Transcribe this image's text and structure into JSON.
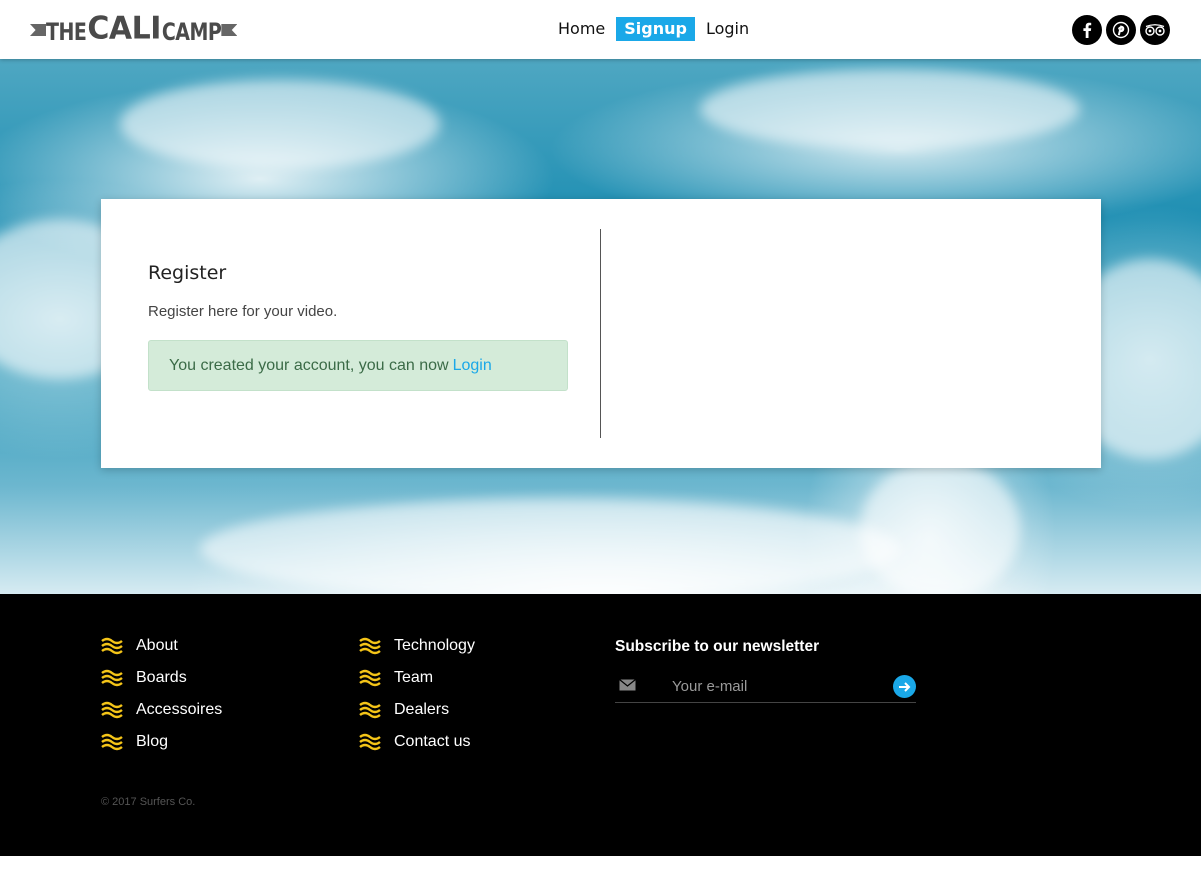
{
  "header": {
    "logo_text": {
      "the": "THE",
      "cali": "CALI",
      "camp": "CAMP"
    },
    "nav": [
      {
        "label": "Home",
        "active": false
      },
      {
        "label": "Signup",
        "active": true
      },
      {
        "label": "Login",
        "active": false
      }
    ],
    "social_icons": [
      "facebook-icon",
      "pinterest-icon",
      "tripadvisor-icon"
    ]
  },
  "card": {
    "title": "Register",
    "subtitle": "Register here for your video.",
    "alert_text": "You created your account, you can now",
    "alert_link": "Login"
  },
  "footer": {
    "col1": [
      "About",
      "Boards",
      "Accessoires",
      "Blog"
    ],
    "col2": [
      "Technology",
      "Team",
      "Dealers",
      "Contact us"
    ],
    "newsletter_title": "Subscribe to our newsletter",
    "email_placeholder": "Your e-mail",
    "copyright": "© 2017 Surfers Co."
  },
  "colors": {
    "accent": "#1aa8e8",
    "wave_icon": "#f5c518",
    "alert_bg": "#d4ebd9",
    "footer_bg": "#000000"
  }
}
